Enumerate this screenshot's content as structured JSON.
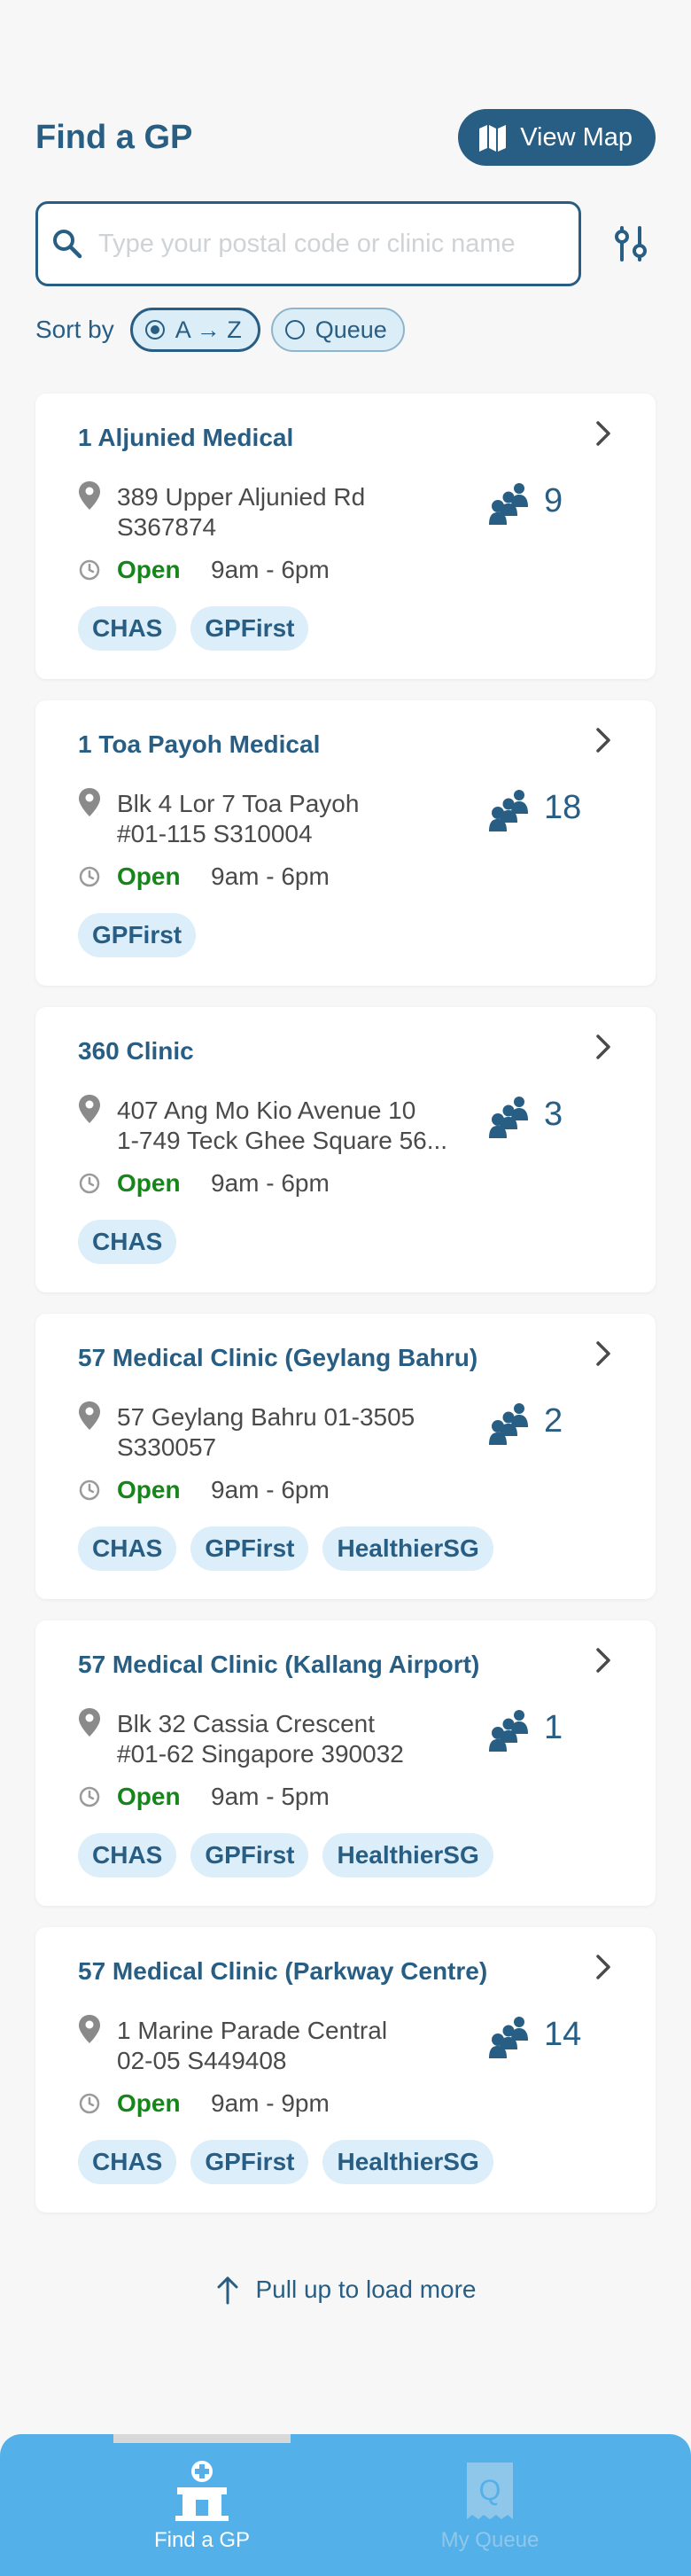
{
  "header": {
    "title": "Find a GP",
    "map_button": "View Map"
  },
  "search": {
    "placeholder": "Type your postal code or clinic name",
    "value": ""
  },
  "sort": {
    "label": "Sort by",
    "options": [
      {
        "label": "A → Z",
        "selected": true
      },
      {
        "label": "Queue",
        "selected": false
      }
    ]
  },
  "clinics": [
    {
      "name": "1 Aljunied Medical",
      "address_line1": "389 Upper Aljunied Rd",
      "address_line2": "S367874",
      "queue": "9",
      "status": "Open",
      "hours": "9am - 6pm",
      "tags": [
        "CHAS",
        "GPFirst"
      ]
    },
    {
      "name": "1 Toa Payoh Medical",
      "address_line1": "Blk 4 Lor 7 Toa Payoh",
      "address_line2": "#01-115 S310004",
      "queue": "18",
      "status": "Open",
      "hours": "9am - 6pm",
      "tags": [
        "GPFirst"
      ]
    },
    {
      "name": "360 Clinic",
      "address_line1": "407 Ang Mo Kio Avenue 10",
      "address_line2": "1-749 Teck Ghee Square 56...",
      "queue": "3",
      "status": "Open",
      "hours": "9am - 6pm",
      "tags": [
        "CHAS"
      ]
    },
    {
      "name": "57 Medical Clinic (Geylang Bahru)",
      "address_line1": "57 Geylang Bahru 01-3505",
      "address_line2": "S330057",
      "queue": "2",
      "status": "Open",
      "hours": "9am - 6pm",
      "tags": [
        "CHAS",
        "GPFirst",
        "HealthierSG"
      ]
    },
    {
      "name": "57 Medical Clinic (Kallang Airport)",
      "address_line1": "Blk 32 Cassia Crescent",
      "address_line2": "#01-62 Singapore 390032",
      "queue": "1",
      "status": "Open",
      "hours": "9am - 5pm",
      "tags": [
        "CHAS",
        "GPFirst",
        "HealthierSG"
      ]
    },
    {
      "name": "57 Medical Clinic (Parkway Centre)",
      "address_line1": "1 Marine Parade Central",
      "address_line2": "02-05 S449408",
      "queue": "14",
      "status": "Open",
      "hours": "9am - 9pm",
      "tags": [
        "CHAS",
        "GPFirst",
        "HealthierSG"
      ]
    }
  ],
  "load_more": "Pull up to load more",
  "nav": {
    "items": [
      {
        "label": "Find a GP",
        "active": true
      },
      {
        "label": "My Queue",
        "active": false
      }
    ]
  },
  "colors": {
    "primary": "#285e84",
    "open": "#16861b",
    "tag_bg": "#dceef9",
    "nav_bg": "#54b0e8",
    "page_bg": "#f7f7f7"
  }
}
